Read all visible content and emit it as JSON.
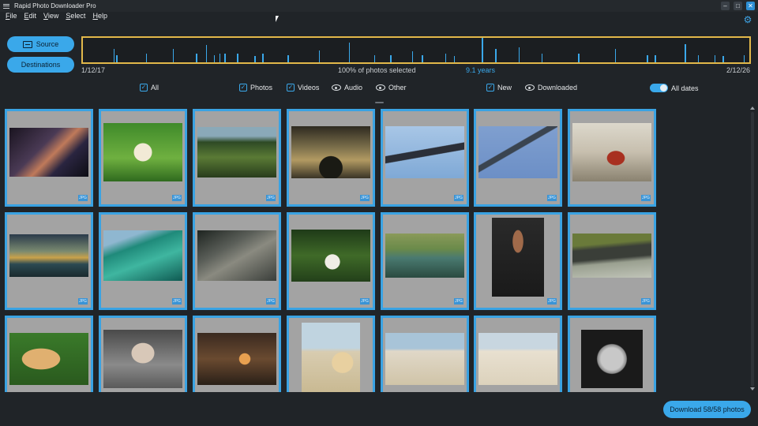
{
  "window": {
    "title": "Rapid Photo Downloader Pro"
  },
  "menu": [
    "File",
    "Edit",
    "View",
    "Select",
    "Help"
  ],
  "buttons": {
    "source": "Source",
    "destinations": "Destinations",
    "download": "Download 58/58 photos"
  },
  "timeline": {
    "start": "1/12/17",
    "end": "2/12/26",
    "selected": "100% of photos selected",
    "span": "9.1 years",
    "ticks": [
      {
        "pos": 0.046,
        "h": 0.55
      },
      {
        "pos": 0.05,
        "h": 0.3
      },
      {
        "pos": 0.095,
        "h": 0.35
      },
      {
        "pos": 0.135,
        "h": 0.55
      },
      {
        "pos": 0.17,
        "h": 0.35
      },
      {
        "pos": 0.185,
        "h": 0.7
      },
      {
        "pos": 0.197,
        "h": 0.3
      },
      {
        "pos": 0.205,
        "h": 0.35
      },
      {
        "pos": 0.213,
        "h": 0.35
      },
      {
        "pos": 0.232,
        "h": 0.35
      },
      {
        "pos": 0.258,
        "h": 0.25
      },
      {
        "pos": 0.27,
        "h": 0.35
      },
      {
        "pos": 0.308,
        "h": 0.3
      },
      {
        "pos": 0.355,
        "h": 0.5
      },
      {
        "pos": 0.4,
        "h": 0.8
      },
      {
        "pos": 0.438,
        "h": 0.3
      },
      {
        "pos": 0.462,
        "h": 0.3
      },
      {
        "pos": 0.495,
        "h": 0.45
      },
      {
        "pos": 0.51,
        "h": 0.3
      },
      {
        "pos": 0.545,
        "h": 0.35
      },
      {
        "pos": 0.558,
        "h": 0.25
      },
      {
        "pos": 0.6,
        "h": 1.0
      },
      {
        "pos": 0.62,
        "h": 0.55
      },
      {
        "pos": 0.655,
        "h": 0.6
      },
      {
        "pos": 0.69,
        "h": 0.35
      },
      {
        "pos": 0.745,
        "h": 0.35
      },
      {
        "pos": 0.8,
        "h": 0.55
      },
      {
        "pos": 0.848,
        "h": 0.3
      },
      {
        "pos": 0.86,
        "h": 0.3
      },
      {
        "pos": 0.905,
        "h": 0.75
      },
      {
        "pos": 0.925,
        "h": 0.3
      },
      {
        "pos": 0.95,
        "h": 0.3
      },
      {
        "pos": 0.962,
        "h": 0.25
      },
      {
        "pos": 0.994,
        "h": 0.3
      }
    ]
  },
  "filters": {
    "all": "All",
    "photos": "Photos",
    "videos": "Videos",
    "audio": "Audio",
    "other": "Other",
    "new": "New",
    "downloaded": "Downloaded",
    "all_dates": "All dates"
  },
  "thumb_badge": "JPG",
  "thumbnails": [
    {
      "icon": "nebula-photo",
      "w": 100,
      "h": 62,
      "bg": "linear-gradient(135deg,#1a1420,#4a3a55 40%,#c07a5a 55%,#2a2540 70%,#0d0d14)"
    },
    {
      "icon": "puppy-grass-photo",
      "w": 100,
      "h": 74,
      "bg": "radial-gradient(circle at 50% 50%,#f2ead6 0 18%,transparent 19%),linear-gradient(#3f8a2a,#6fb040 60%,#2f6a1e)"
    },
    {
      "icon": "green-hills-photo",
      "w": 100,
      "h": 64,
      "bg": "linear-gradient(#8aa9b8 0 18%,#2e4a25 30%,#5a7a35 60%,#283c1c)"
    },
    {
      "icon": "storm-clouds-photo",
      "w": 100,
      "h": 66,
      "bg": "radial-gradient(circle at 50% 80%,#1a1a14 0 20%,transparent 21%),linear-gradient(#2e2a20,#7a6e4a 40%,#b29a62 65%,#3a3426)"
    },
    {
      "icon": "fighter-jet-photo",
      "w": 100,
      "h": 66,
      "bg": "linear-gradient(170deg,transparent 45%,#2b2f38 46% 56%,transparent 57%),linear-gradient(#a8c6e6,#7fa9d6)"
    },
    {
      "icon": "two-jets-photo",
      "w": 100,
      "h": 66,
      "bg": "linear-gradient(150deg,transparent 40%,#3a4450 41% 47%,transparent 48%),linear-gradient(#7f9fcf,#6c8fc6)"
    },
    {
      "icon": "racing-driver-photo",
      "w": 100,
      "h": 74,
      "bg": "radial-gradient(ellipse at 55% 60%,#a83020 0 14%,transparent 15%),linear-gradient(#dcd8cc,#c7bfae 50%,#8a8270)"
    },
    {
      "icon": "coast-sunset-photo",
      "w": 100,
      "h": 54,
      "bg": "linear-gradient(#2a3a4a,#7a8a70 40%,#caa24a 55%,#2c4a52 70%,#1a2a2e)"
    },
    {
      "icon": "ocean-wave-photo",
      "w": 100,
      "h": 64,
      "bg": "linear-gradient(160deg,#8fb7d0 0 20%,#1f8a7a 35%,#3fb6a0 60%,#0f5a52)"
    },
    {
      "icon": "rock-formation-photo",
      "w": 100,
      "h": 64,
      "bg": "linear-gradient(150deg,#1e2420,#5a5e58 35%,#8a8a80 55%,#3a3e3a)"
    },
    {
      "icon": "puppy-forest-photo",
      "w": 100,
      "h": 66,
      "bg": "radial-gradient(circle at 52% 62%,#f0ede6 0 14%,transparent 15%),linear-gradient(#1e3a18,#3f6a28 50%,#23401a)"
    },
    {
      "icon": "lake-shore-photo",
      "w": 100,
      "h": 56,
      "bg": "linear-gradient(#8a9a5a,#6a8a4a 35%,#4a7a70 55%,#2a4a40)"
    },
    {
      "icon": "woman-portrait-photo",
      "w": 66,
      "h": 100,
      "bg": "radial-gradient(ellipse at 50% 30%,#a06a4a 0 14%,transparent 15%),linear-gradient(#2a2a2a,#1a1a1a)"
    },
    {
      "icon": "snake-photo",
      "w": 100,
      "h": 56,
      "bg": "linear-gradient(175deg,#6a7a3a 0 25%,#3a3e38 35% 55%,#9aa090 65%,#c0c4b8)"
    },
    {
      "icon": "golden-retriever-photo",
      "w": 100,
      "h": 66,
      "bg": "radial-gradient(ellipse at 40% 50%,#e0b070 0 28%,transparent 29%),linear-gradient(#3a7a2a,#2a5a1e)"
    },
    {
      "icon": "elderly-woman-photo",
      "w": 100,
      "h": 74,
      "bg": "radial-gradient(ellipse at 50% 40%,#d8c8b8 0 20%,transparent 21%),linear-gradient(#4a4a4a,#8a8a8a 60%,#5a5a5a)"
    },
    {
      "icon": "garden-party-photo",
      "w": 100,
      "h": 66,
      "bg": "radial-gradient(circle at 60% 50%,#e8a050 0 10%,transparent 11%),linear-gradient(#3a2a20,#6a4a30 50%,#2a2018)"
    },
    {
      "icon": "boy-dog-beach-photo",
      "w": 74,
      "h": 92,
      "bg": "radial-gradient(ellipse at 70% 55%,#e8d0a0 0 18%,transparent 19%),linear-gradient(#c0d4e0 0 35%,#d8ccb0 40%,#c8b890)"
    },
    {
      "icon": "kids-beach-photo",
      "w": 100,
      "h": 66,
      "bg": "linear-gradient(#a8c4d8 0 30%,#e0d8c8 35%,#d0c4a8)"
    },
    {
      "icon": "girls-beach-photo",
      "w": 100,
      "h": 66,
      "bg": "linear-gradient(#c8d6e0 0 30%,#e8e0d0 35%,#dcd2bc)"
    },
    {
      "icon": "moon-photo",
      "w": 78,
      "h": 74,
      "bg": "radial-gradient(circle at 50% 50%,#c8c8c8 0 26%,#8a8a8a 34%,#1a1a1a 36%),#000"
    }
  ]
}
